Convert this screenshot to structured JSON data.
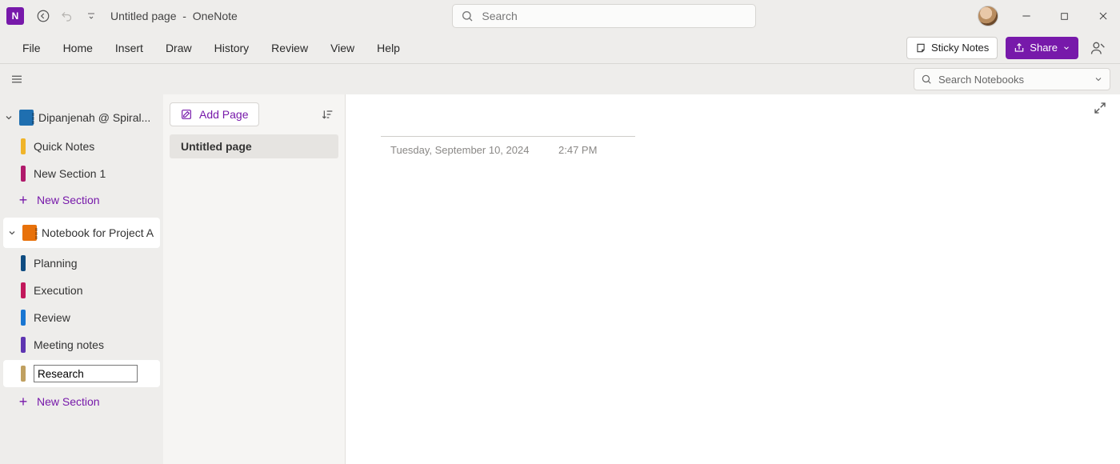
{
  "titlebar": {
    "page_title": "Untitled page",
    "separator": "-",
    "app_name": "OneNote",
    "search_placeholder": "Search"
  },
  "menubar": {
    "items": [
      "File",
      "Home",
      "Insert",
      "Draw",
      "History",
      "Review",
      "View",
      "Help"
    ],
    "sticky_label": "Sticky Notes",
    "share_label": "Share"
  },
  "subbar": {
    "search_placeholder": "Search Notebooks"
  },
  "sidebar": {
    "notebooks": [
      {
        "label": "Dipanjenah @ Spiral...",
        "color": "#1f6fb0",
        "selected": false,
        "sections": [
          {
            "label": "Quick Notes",
            "color": "#f0b429"
          },
          {
            "label": "New Section 1",
            "color": "#b01a6b"
          }
        ]
      },
      {
        "label": "Notebook for Project A",
        "color": "#e8710a",
        "selected": true,
        "sections": [
          {
            "label": "Planning",
            "color": "#0f4c81"
          },
          {
            "label": "Execution",
            "color": "#c2185b"
          },
          {
            "label": "Review",
            "color": "#1976d2"
          },
          {
            "label": "Meeting notes",
            "color": "#5e35b1"
          },
          {
            "label": "Research",
            "color": "#c0a060",
            "editing": true
          }
        ]
      }
    ],
    "new_section_label": "New Section"
  },
  "pagelist": {
    "add_page_label": "Add Page",
    "pages": [
      {
        "label": "Untitled page",
        "active": true
      }
    ]
  },
  "canvas": {
    "date": "Tuesday, September 10, 2024",
    "time": "2:47 PM"
  }
}
